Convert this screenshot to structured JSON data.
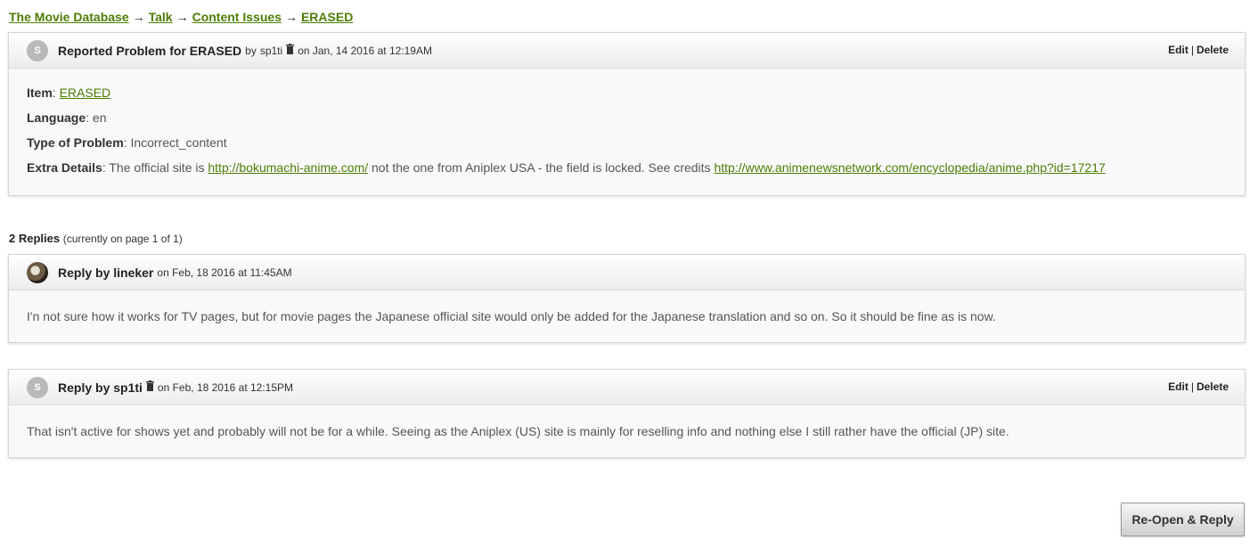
{
  "breadcrumb": {
    "items": [
      "The Movie Database",
      "Talk",
      "Content Issues",
      "ERASED"
    ],
    "separator": "→"
  },
  "report": {
    "avatar_initials": "S",
    "title": "Reported Problem for ERASED",
    "by_label": "by",
    "user": "sp1ti",
    "date": "on Jan, 14 2016 at 12:19AM",
    "edit_label": "Edit",
    "action_separator": "|",
    "delete_label": "Delete",
    "item_label": "Item",
    "item_value": "ERASED",
    "language_label": "Language",
    "language_value": "en",
    "type_label": "Type of Problem",
    "type_value": "Incorrect_content",
    "extra_label": "Extra Details",
    "extra_text_1": "The official site is",
    "extra_link_1": "http://bokumachi-anime.com/",
    "extra_text_2": "not the one from Aniplex USA - the field is locked. See credits",
    "extra_link_2": "http://www.animenewsnetwork.com/encyclopedia/anime.php?id=17217"
  },
  "replies": {
    "count_label": "2 Replies",
    "page_info": "(currently on page 1 of 1)",
    "items": [
      {
        "title": "Reply by lineker",
        "date": "on Feb, 18 2016 at 11:45AM",
        "text": "I'n not sure how it works for TV pages, but for movie pages the Japanese official site would only be added for the Japanese translation and so on. So it should be fine as is now."
      },
      {
        "avatar_initials": "S",
        "title": "Reply by sp1ti",
        "date": "on Feb, 18 2016 at 12:15PM",
        "edit_label": "Edit",
        "action_separator": "|",
        "delete_label": "Delete",
        "text": "That isn't active for shows yet and probably will not be for a while. Seeing as the Aniplex (US) site is mainly for reselling info and nothing else I still rather have the official (JP) site."
      }
    ]
  },
  "reopen_button": "Re-Open & Reply"
}
